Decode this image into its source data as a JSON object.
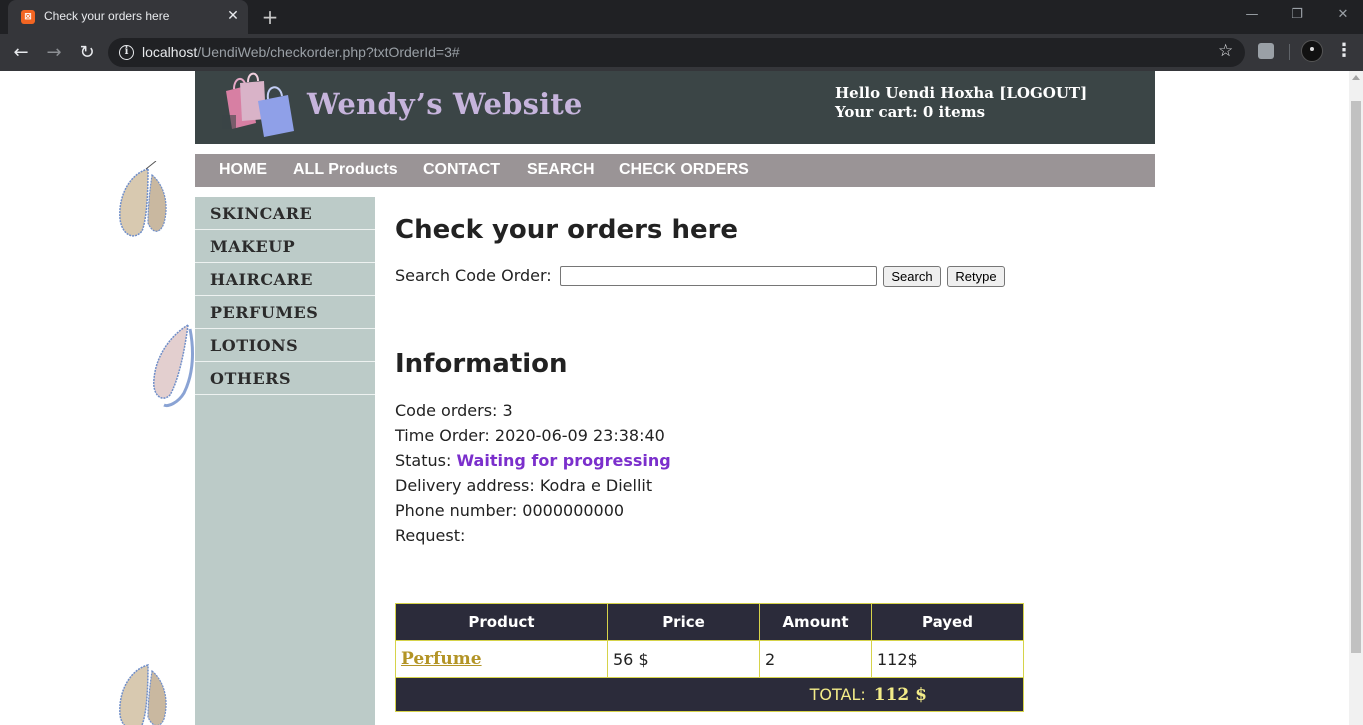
{
  "browser": {
    "tab_title": "Check your orders here",
    "url_host": "localhost",
    "url_path": "/UendiWeb/checkorder.php?txtOrderId=3#"
  },
  "header": {
    "site_name": "Wendy’s Website",
    "greeting": "Hello Uendi Hoxha",
    "logout_label": "[LOGOUT]",
    "cart_text": "Your cart: 0 items"
  },
  "topnav": {
    "items": [
      "HOME",
      "ALL Products",
      "CONTACT",
      "SEARCH",
      "CHECK ORDERS"
    ]
  },
  "sidebar": {
    "items": [
      "SKINCARE",
      "MAKEUP",
      "HAIRCARE",
      "PERFUMES",
      "LOTIONS",
      "OTHERS"
    ]
  },
  "main": {
    "title": "Check your orders here",
    "search_label": "Search Code Order:",
    "search_value": "",
    "search_button": "Search",
    "retype_button": "Retype",
    "info_title": "Information",
    "code_label": "Code orders:",
    "code_value": "3",
    "time_label": "Time Order:",
    "time_value": "2020-06-09 23:38:40",
    "status_label": "Status:",
    "status_value": "Waiting for progressing",
    "address_label": "Delivery address:",
    "address_value": "Kodra e Diellit",
    "phone_label": "Phone number:",
    "phone_value": "0000000000",
    "request_label": "Request:",
    "request_value": ""
  },
  "orders_table": {
    "headers": [
      "Product",
      "Price",
      "Amount",
      "Payed"
    ],
    "rows": [
      {
        "product": "Perfume",
        "price": "56 $",
        "amount": "2",
        "payed": "112$"
      }
    ],
    "total_label": "TOTAL:",
    "total_value": "112 $"
  },
  "colors": {
    "header_bg": "#3b4546",
    "nav_bg": "#9a9496",
    "sidebar_bg": "#bccbc8",
    "status": "#7b2fcc",
    "table_head": "#2b2b3a",
    "table_border": "#d6d34a"
  }
}
